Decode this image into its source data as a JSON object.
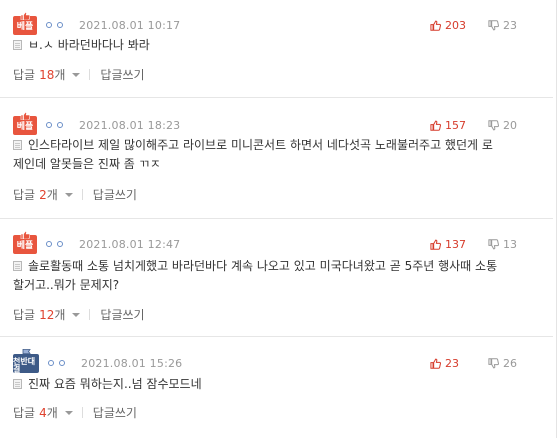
{
  "badges": {
    "best": "베플",
    "rival": "천반대결"
  },
  "comments": [
    {
      "badge": "best",
      "date": "2021.08.01 10:17",
      "up": "203",
      "down": "23",
      "lines": [
        "ㅂ.ㅅ 바라던바다나 봐라"
      ],
      "reply_label": "답글",
      "reply_count": "18",
      "reply_unit": "개",
      "write_label": "답글쓰기"
    },
    {
      "badge": "best",
      "date": "2021.08.01 18:23",
      "up": "157",
      "down": "20",
      "lines": [
        "인스타라이브 제일 많이해주고 라이브로 미니콘서트 하면서 네다섯곡 노래불러주고 했던게 로",
        "제인데 알못들은 진짜 좀 ㄲㅈ"
      ],
      "reply_label": "답글",
      "reply_count": "2",
      "reply_unit": "개",
      "write_label": "답글쓰기"
    },
    {
      "badge": "best",
      "date": "2021.08.01 12:47",
      "up": "137",
      "down": "13",
      "lines": [
        "솔로활동때 소통 넘치게했고 바라던바다 계속 나오고 있고 미국다녀왔고 곧 5주년 행사때 소통",
        "할거고..뭐가 문제지?"
      ],
      "reply_label": "답글",
      "reply_count": "12",
      "reply_unit": "개",
      "write_label": "답글쓰기"
    },
    {
      "badge": "rival",
      "date": "2021.08.01 15:26",
      "up": "23",
      "down": "26",
      "lines": [
        "진짜 요즘 뭐하는지..넘 잠수모드네"
      ],
      "reply_label": "답글",
      "reply_count": "4",
      "reply_unit": "개",
      "write_label": "답글쓰기"
    }
  ]
}
